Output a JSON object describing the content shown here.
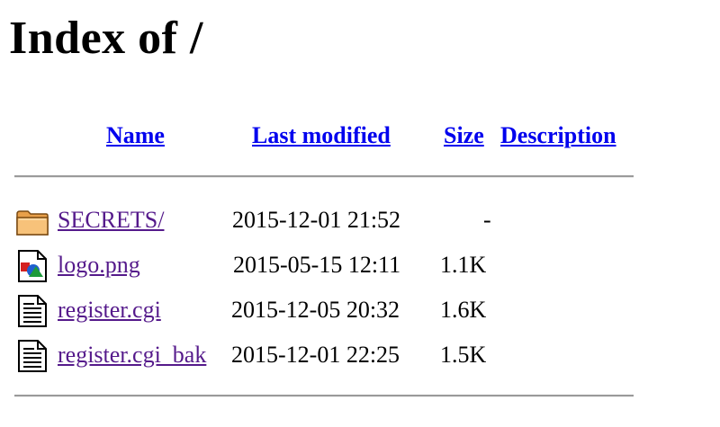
{
  "page": {
    "title": "Index of /"
  },
  "columns": {
    "name": "Name",
    "last_modified": "Last modified",
    "size": "Size",
    "description": "Description"
  },
  "entries": [
    {
      "icon": "folder-icon",
      "name": "SECRETS/",
      "last_modified": "2015-12-01 21:52",
      "size": "-",
      "description": ""
    },
    {
      "icon": "image-file-icon",
      "name": "logo.png",
      "last_modified": "2015-05-15 12:11",
      "size": "1.1K",
      "description": ""
    },
    {
      "icon": "text-file-icon",
      "name": "register.cgi",
      "last_modified": "2015-12-05 20:32",
      "size": "1.6K",
      "description": ""
    },
    {
      "icon": "text-file-icon",
      "name": "register.cgi_bak",
      "last_modified": "2015-12-01 22:25",
      "size": "1.5K",
      "description": ""
    }
  ],
  "colors": {
    "link": "#0000ee",
    "visited_link": "#551a8b",
    "rule": "#9a9a9a"
  }
}
